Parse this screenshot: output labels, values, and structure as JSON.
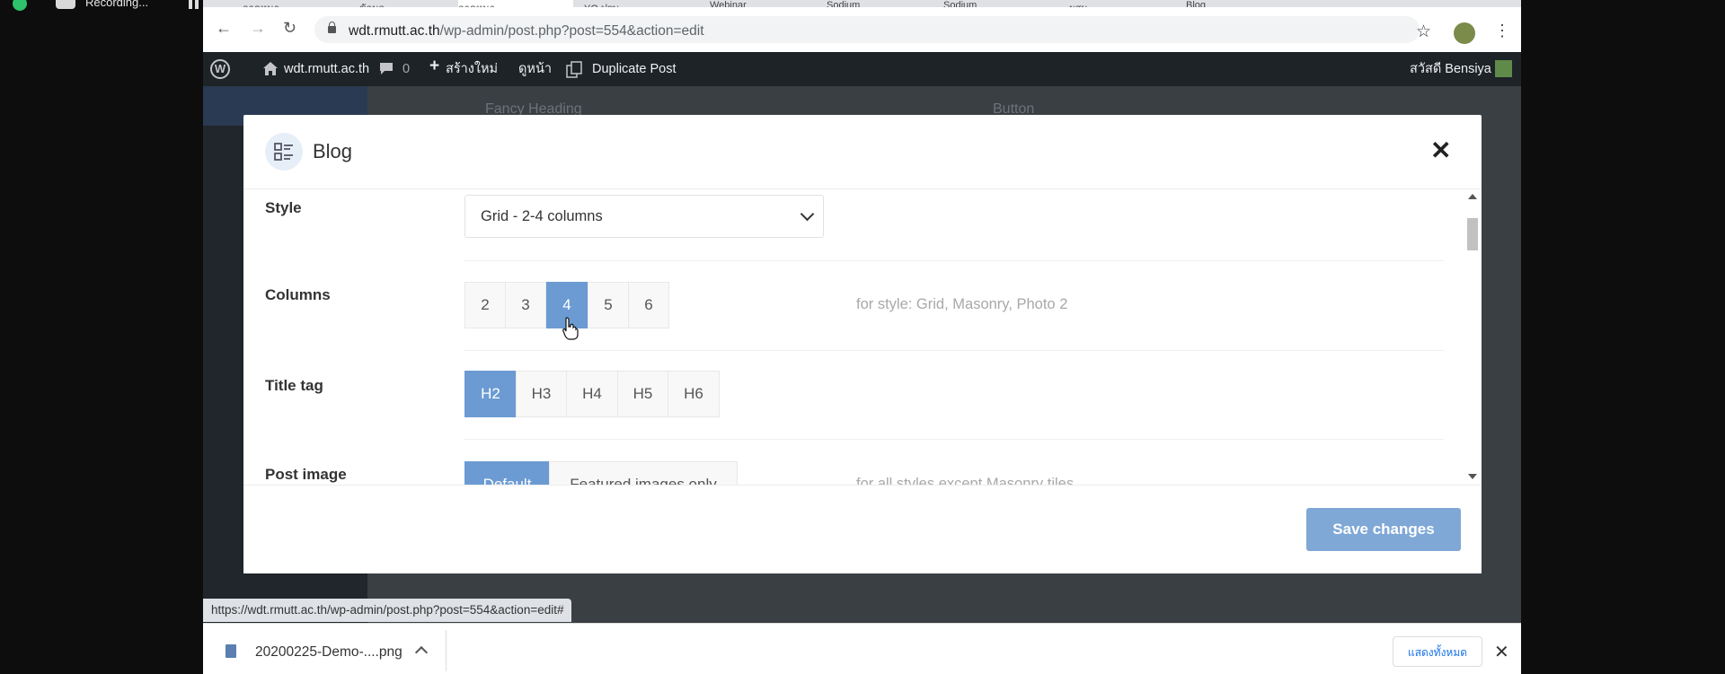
{
  "recording": {
    "label": "Recording..."
  },
  "browser": {
    "tabs": [
      {
        "label": "ลาดหนา"
      },
      {
        "label": "ข้อมูล"
      },
      {
        "label": "ลาดหนา"
      },
      {
        "label": "YO ปรบ"
      },
      {
        "label": "Webinar"
      },
      {
        "label": "Sodium"
      },
      {
        "label": "Sodium"
      },
      {
        "label": "ผสม"
      },
      {
        "label": "Blog"
      }
    ],
    "url_host": "wdt.rmutt.ac.th",
    "url_path": "/wp-admin/post.php?post=554&action=edit",
    "back_icon": "←",
    "forward_icon": "→",
    "reload_icon": "↻",
    "star_icon": "☆",
    "menu_icon": "⋮"
  },
  "wp_admin_bar": {
    "site": "wdt.rmutt.ac.th",
    "comments_count": "0",
    "new_label": "สร้างใหม่",
    "view_label": "ดูหน้า",
    "duplicate_label": "Duplicate Post",
    "greeting": "สวัสดี Bensiya"
  },
  "modal": {
    "title": "Blog",
    "close_icon": "✕",
    "fields": {
      "style": {
        "label": "Style",
        "value": "Grid - 2-4 columns"
      },
      "columns": {
        "label": "Columns",
        "options": [
          "2",
          "3",
          "4",
          "5",
          "6"
        ],
        "selected": "4",
        "hint": "for style: Grid, Masonry, Photo 2"
      },
      "title_tag": {
        "label": "Title tag",
        "options": [
          "H2",
          "H3",
          "H4",
          "H5",
          "H6"
        ],
        "selected": "H2"
      },
      "post_image": {
        "label": "Post image",
        "options": [
          "Default",
          "Featured images only"
        ],
        "selected": "Default",
        "hint": "for all styles except Masonry tiles"
      }
    },
    "save_label": "Save changes"
  },
  "status_url": "https://wdt.rmutt.ac.th/wp-admin/post.php?post=554&action=edit#",
  "download": {
    "filename": "20200225-Demo-....png",
    "show_all": "แสดงทั้งหมด",
    "close_icon": "✕"
  },
  "colors": {
    "accent": "#6b9bd2",
    "save_button": "#7fa8d6",
    "wp_bar": "#1d2327",
    "recording_dot": "#2ec36a"
  }
}
